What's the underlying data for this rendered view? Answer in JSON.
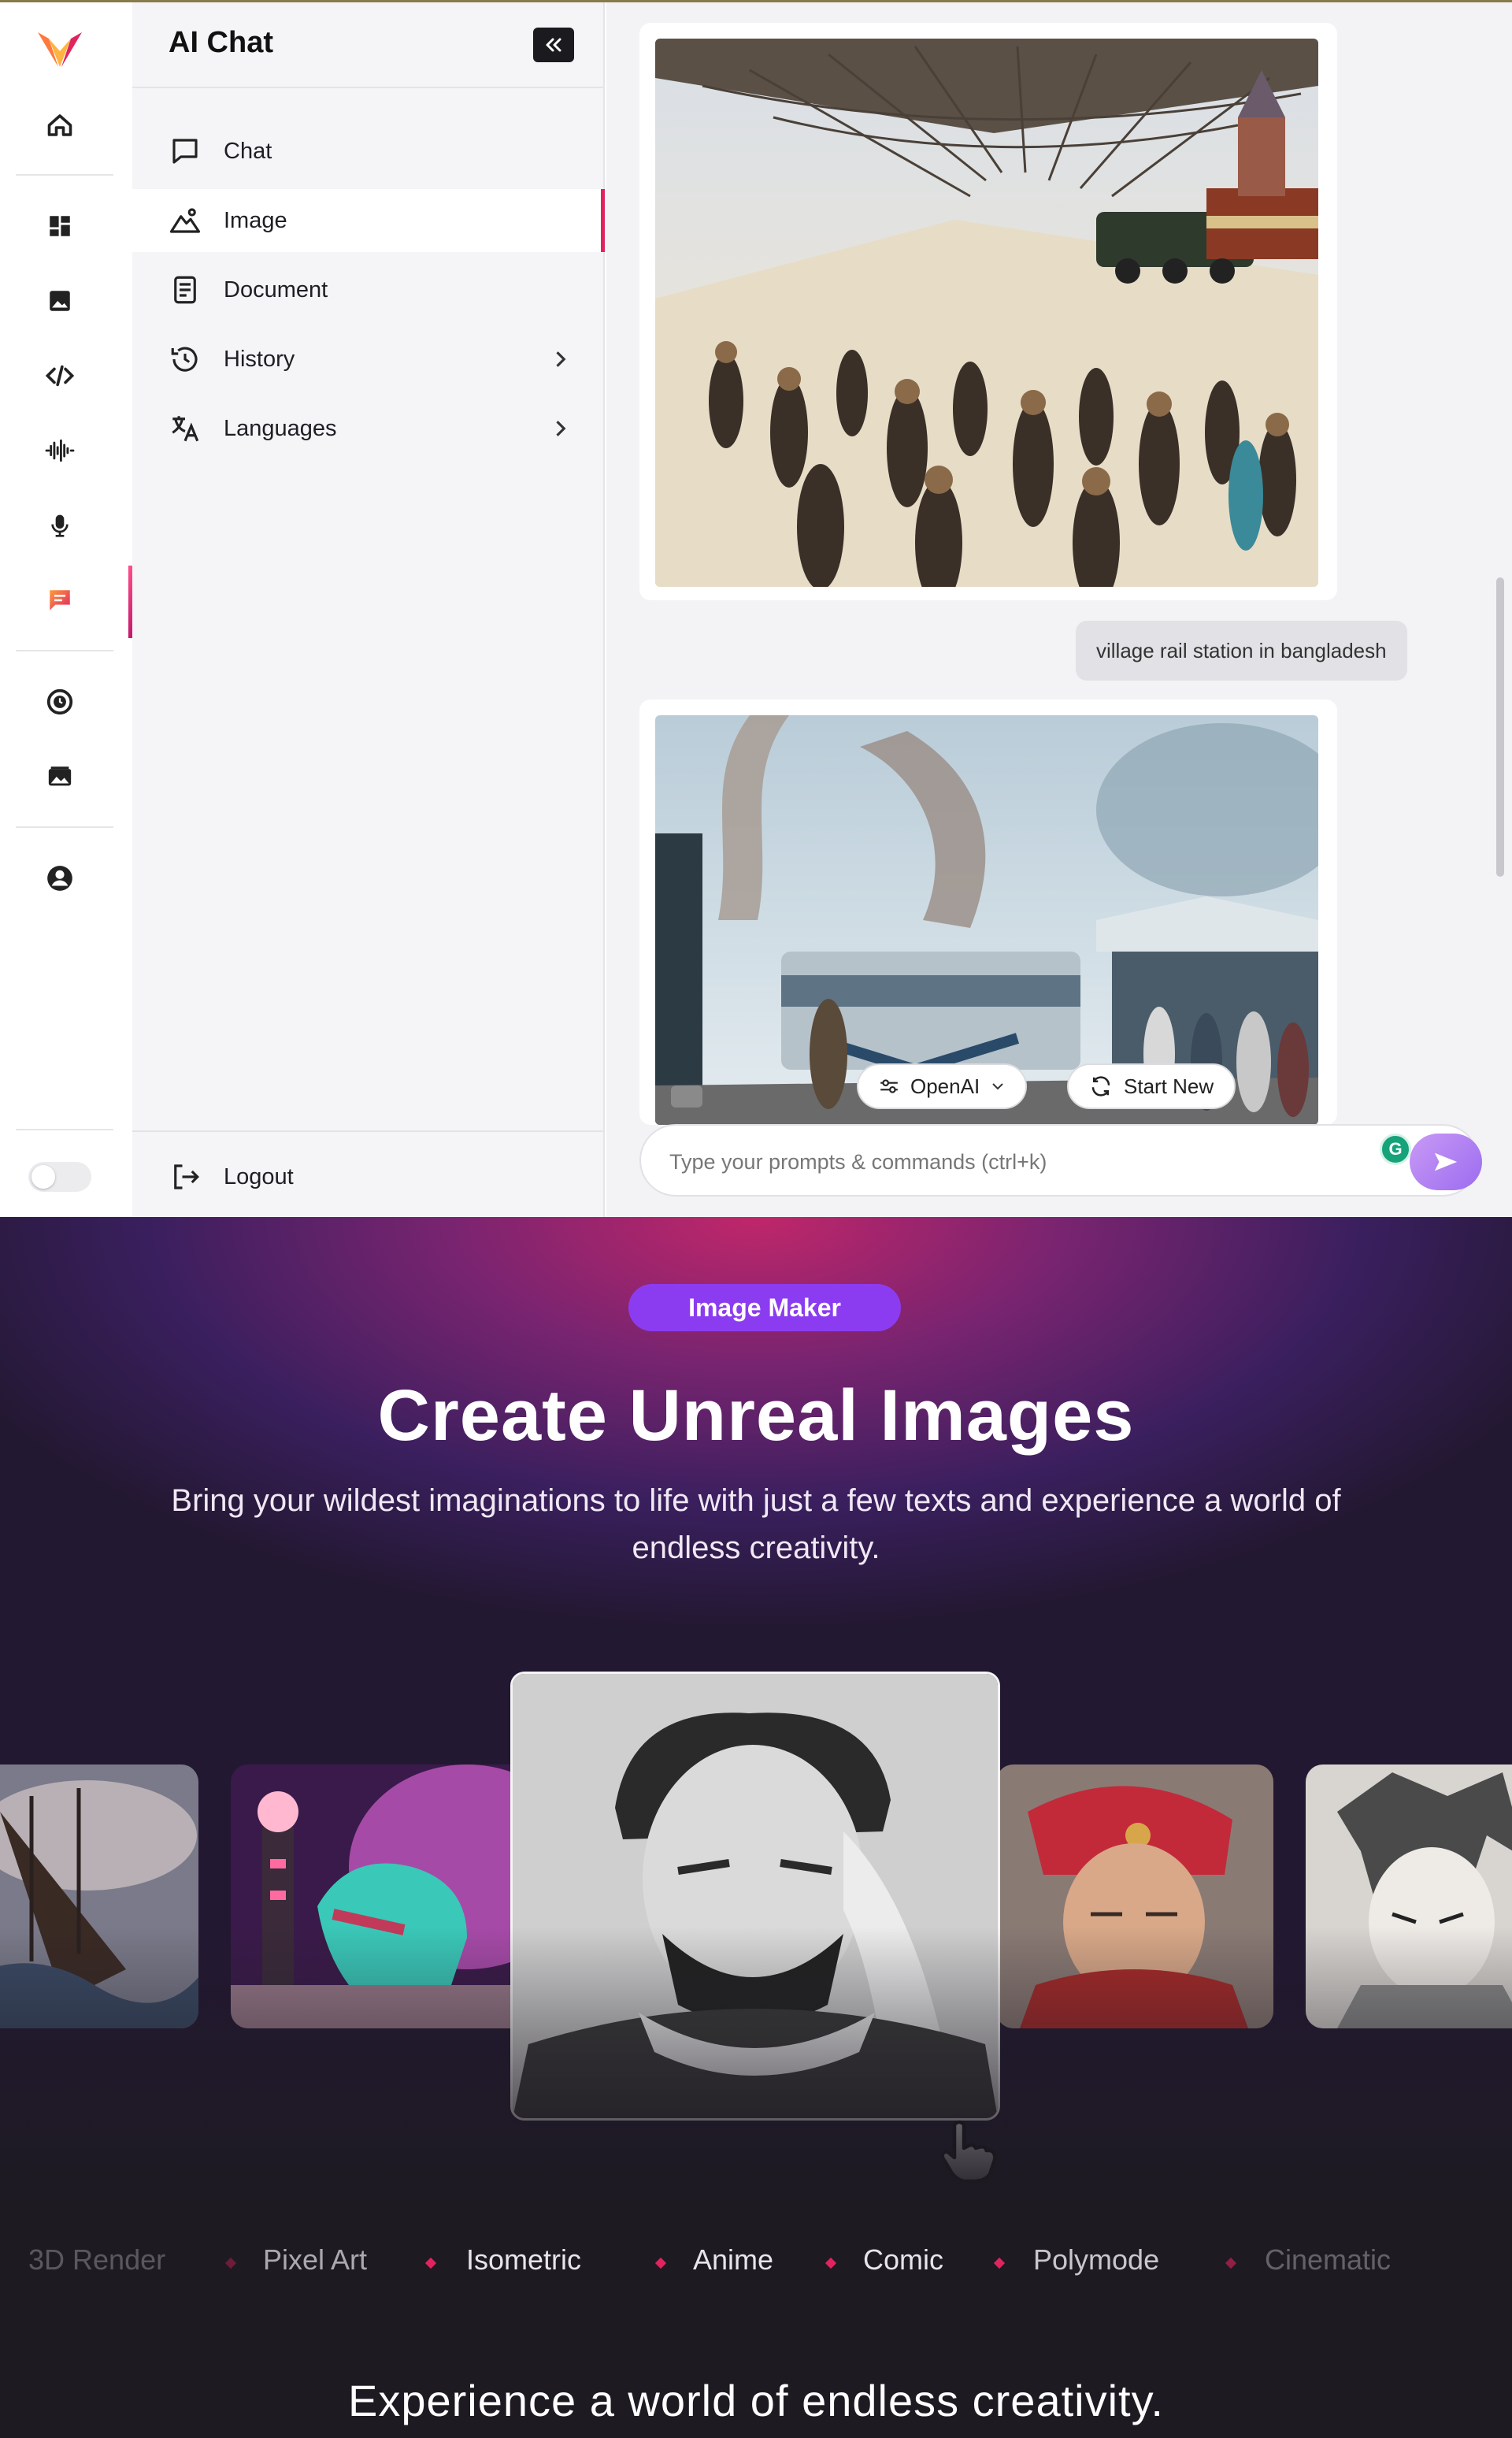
{
  "sidebar_nav": {
    "title": "AI Chat",
    "items": [
      {
        "label": "Chat",
        "icon": "chat-bubble-icon"
      },
      {
        "label": "Image",
        "icon": "image-landscape-icon",
        "active": true
      },
      {
        "label": "Document",
        "icon": "document-icon"
      },
      {
        "label": "History",
        "icon": "history-icon",
        "has_submenu": true
      },
      {
        "label": "Languages",
        "icon": "translate-icon",
        "has_submenu": true
      }
    ],
    "logout_label": "Logout"
  },
  "rail": {
    "icons": [
      "logo-icon",
      "home-icon",
      "dashboard-icon",
      "image-icon",
      "code-icon",
      "audio-wave-icon",
      "microphone-icon",
      "chat-icon",
      "history-clock-icon",
      "gallery-icon",
      "account-icon"
    ],
    "theme_toggle": "off"
  },
  "chat": {
    "user_message": "village rail station in bangladesh",
    "model_selector": "OpenAI",
    "start_new_label": "Start New",
    "prompt_placeholder": "Type your prompts & commands (ctrl+k)"
  },
  "promo": {
    "badge": "Image Maker",
    "title": "Create Unreal Images",
    "subtitle": "Bring your wildest imaginations to life with just a few texts and experience a world of endless creativity.",
    "styles": [
      "3D Render",
      "Pixel Art",
      "Isometric",
      "Anime",
      "Comic",
      "Polymode",
      "Cinematic"
    ],
    "bottom_title": "Experience a world of endless creativity."
  },
  "colors": {
    "accent": "#e0245e",
    "badge_purple": "#8c3cf0",
    "send_button": "#b07ff2"
  }
}
